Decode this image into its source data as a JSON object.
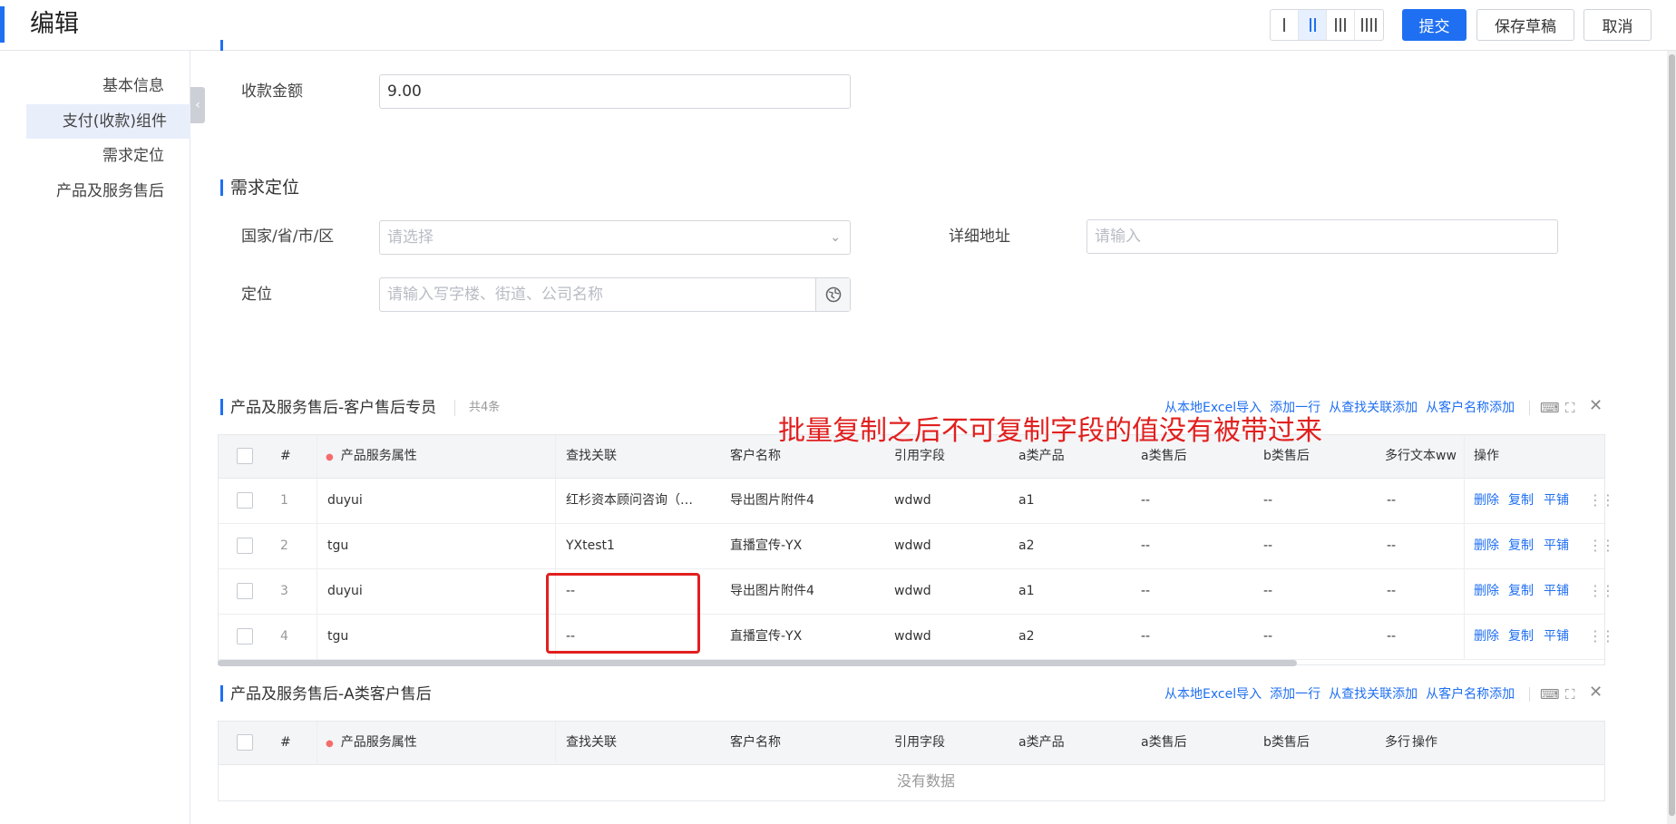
{
  "header": {
    "title": "编辑",
    "buttons": {
      "submit": "提交",
      "save_draft": "保存草稿",
      "cancel": "取消"
    },
    "column_options": [
      "one-column",
      "two-column",
      "three-column",
      "four-column"
    ],
    "active_column_option": "two-column"
  },
  "sidebar": {
    "items": [
      {
        "label": "基本信息"
      },
      {
        "label": "支付(收款)组件",
        "active": true
      },
      {
        "label": "需求定位"
      },
      {
        "label": "产品及服务售后"
      }
    ]
  },
  "payment": {
    "amount_label": "收款金额",
    "amount_value": "9.00"
  },
  "demand": {
    "title": "需求定位",
    "region_label": "国家/省/市/区",
    "region_placeholder": "请选择",
    "address_label": "详细地址",
    "address_placeholder": "请输入",
    "location_label": "定位",
    "location_placeholder": "请输入写字楼、街道、公司名称"
  },
  "table1": {
    "title": "产品及服务售后-客户售后专员",
    "count": "共4条",
    "actions": [
      "从本地Excel导入",
      "添加一行",
      "从查找关联添加",
      "从客户名称添加"
    ],
    "headers": [
      "#",
      "产品服务属性",
      "查找关联",
      "客户名称",
      "引用字段",
      "a类产品",
      "a类售后",
      "b类售后",
      "多行文本ww",
      "操作"
    ],
    "row_ops": [
      "删除",
      "复制",
      "平铺"
    ],
    "rows": [
      {
        "no": "1",
        "attr": "duyui",
        "lookup": "红杉资本顾问咨询（…",
        "customer": "导出图片附件4",
        "ref": "wdwd",
        "a_product": "a1",
        "a_after": "--",
        "b_after": "--",
        "text": "--"
      },
      {
        "no": "2",
        "attr": "tgu",
        "lookup": "YXtest1",
        "customer": "直播宣传-YX",
        "ref": "wdwd",
        "a_product": "a2",
        "a_after": "--",
        "b_after": "--",
        "text": "--"
      },
      {
        "no": "3",
        "attr": "duyui",
        "lookup": "--",
        "customer": "导出图片附件4",
        "ref": "wdwd",
        "a_product": "a1",
        "a_after": "--",
        "b_after": "--",
        "text": "--"
      },
      {
        "no": "4",
        "attr": "tgu",
        "lookup": "--",
        "customer": "直播宣传-YX",
        "ref": "wdwd",
        "a_product": "a2",
        "a_after": "--",
        "b_after": "--",
        "text": "--"
      }
    ]
  },
  "table2": {
    "title": "产品及服务售后-A类客户售后",
    "actions": [
      "从本地Excel导入",
      "添加一行",
      "从查找关联添加",
      "从客户名称添加"
    ],
    "headers": [
      "#",
      "产品服务属性",
      "查找关联",
      "客户名称",
      "引用字段",
      "a类产品",
      "a类售后",
      "b类售后",
      "多行",
      "操作"
    ],
    "empty_text": "没有数据"
  },
  "annotation": {
    "text": "批量复制之后不可复制字段的值没有被带过来",
    "color": "#e0201f"
  },
  "colors": {
    "accent": "#1f6ff2",
    "annotation": "#e0201f"
  }
}
